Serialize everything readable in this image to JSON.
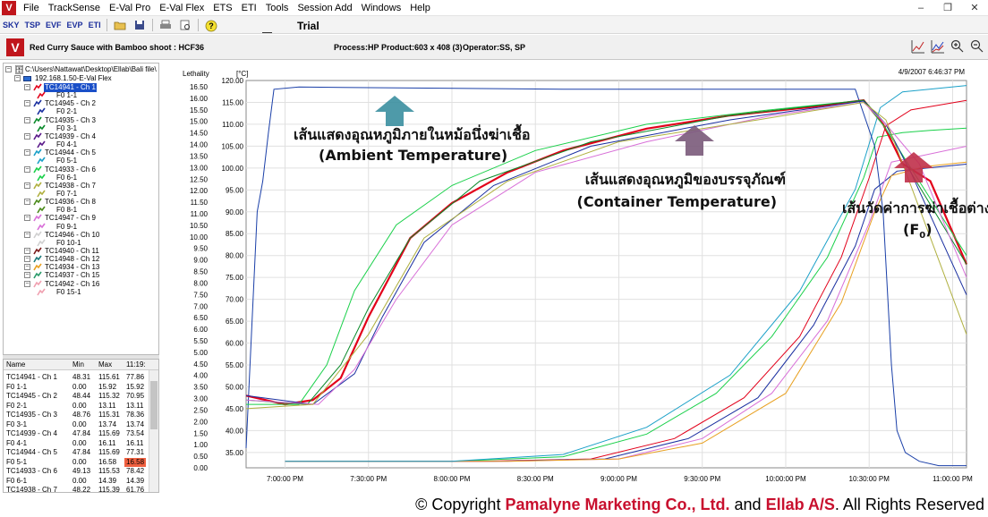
{
  "menubar": {
    "logo": "V",
    "items": [
      "File",
      "TrackSense",
      "E-Val Pro",
      "E-Val Flex",
      "ETS",
      "ETI",
      "Tools",
      "Session Add",
      "Windows",
      "Help"
    ],
    "window_controls": [
      "–",
      "❐",
      "✕"
    ]
  },
  "toolbar": {
    "buttons": [
      "SKY",
      "TSP",
      "EVF",
      "EVP",
      "ETI"
    ],
    "title": "Trial"
  },
  "infobar": {
    "product": "Red Curry Sauce with Bamboo shoot : HCF36",
    "process": "Process:HP",
    "product_size": "Product:603 x 408 (3)",
    "operator": "Operator:SS, SP"
  },
  "tree": {
    "root": "C:\\Users\\Nattawat\\Desktop\\Ellab\\Bali file\\",
    "device": "192.168.1.50-E-Val Flex",
    "channels": [
      {
        "label": "TC14941 - Ch 1",
        "color": "#e2001a",
        "f0": "F0 1-1",
        "f0color": "#e2001a",
        "selected": true
      },
      {
        "label": "TC14945 - Ch 2",
        "color": "#1a2fa0",
        "f0": "F0 2-1",
        "f0color": "#1a2fa0"
      },
      {
        "label": "TC14935 - Ch 3",
        "color": "#0a8a2a",
        "f0": "F0 3-1",
        "f0color": "#0a8a2a"
      },
      {
        "label": "TC14939 - Ch 4",
        "color": "#5a1a8a",
        "f0": "F0 4-1",
        "f0color": "#5a1a8a"
      },
      {
        "label": "TC14944 - Ch 5",
        "color": "#1aa0c8",
        "f0": "F0 5-1",
        "f0color": "#1aa0c8"
      },
      {
        "label": "TC14933 - Ch 6",
        "color": "#1ad04a",
        "f0": "F0 6-1",
        "f0color": "#1ad04a"
      },
      {
        "label": "TC14938 - Ch 7",
        "color": "#b0b040",
        "f0": "F0 7-1",
        "f0color": "#b0b040"
      },
      {
        "label": "TC14936 - Ch 8",
        "color": "#4a8a1a",
        "f0": "F0 8-1",
        "f0color": "#4a8a1a"
      },
      {
        "label": "TC14947 - Ch 9",
        "color": "#d870d8",
        "f0": "F0 9-1",
        "f0color": "#d870d8"
      },
      {
        "label": "TC14946 - Ch 10",
        "color": "#d0d0d0",
        "f0": "F0 10-1",
        "f0color": "#d0d0d0"
      }
    ],
    "extra_channels": [
      {
        "label": "TC14940 - Ch 11",
        "color": "#7a1a1a"
      },
      {
        "label": "TC14948 - Ch 12",
        "color": "#1a7a7a"
      },
      {
        "label": "TC14934 - Ch 13",
        "color": "#e8a020"
      },
      {
        "label": "TC14937 - Ch 15",
        "color": "#2a9a6a"
      },
      {
        "label": "TC14942 - Ch 16",
        "color": "#f0a0b0",
        "f0": "F0 15-1",
        "f0color": "#f0a0b0"
      }
    ]
  },
  "stats": {
    "headers": [
      "Name",
      "Min",
      "Max",
      "11:19:"
    ],
    "rows": [
      [
        "TC14941 - Ch 1",
        "48.31",
        "115.61",
        "77.86"
      ],
      [
        "F0 1-1",
        "0.00",
        "15.92",
        "15.92"
      ],
      [
        "TC14945 - Ch 2",
        "48.44",
        "115.32",
        "70.95"
      ],
      [
        "F0 2-1",
        "0.00",
        "13.11",
        "13.11"
      ],
      [
        "TC14935 - Ch 3",
        "48.76",
        "115.31",
        "78.36"
      ],
      [
        "F0 3-1",
        "0.00",
        "13.74",
        "13.74"
      ],
      [
        "TC14939 - Ch 4",
        "47.84",
        "115.69",
        "73.54"
      ],
      [
        "F0 4-1",
        "0.00",
        "16.11",
        "16.11"
      ],
      [
        "TC14944 - Ch 5",
        "47.84",
        "115.69",
        "77.31"
      ],
      [
        "F0 5-1",
        "0.00",
        "16.58",
        "16.58"
      ],
      [
        "TC14933 - Ch 6",
        "49.13",
        "115.53",
        "78.42"
      ],
      [
        "F0 6-1",
        "0.00",
        "14.39",
        "14.39"
      ],
      [
        "TC14938 - Ch 7",
        "48.22",
        "115.39",
        "61.76"
      ]
    ],
    "highlight_row": 9,
    "highlight_color": "#f06040"
  },
  "chart_data": {
    "type": "line",
    "title": "",
    "datetime": "4/9/2007 6:46:37 PM",
    "ylabel_left": "Lethality",
    "ylabel_right": "[°C]",
    "lethality_ticks": [
      "16.50",
      "16.00",
      "15.50",
      "15.00",
      "14.50",
      "14.00",
      "13.50",
      "13.00",
      "12.50",
      "12.00",
      "11.50",
      "11.00",
      "10.50",
      "10.00",
      "9.50",
      "9.00",
      "8.50",
      "8.00",
      "7.50",
      "7.00",
      "6.50",
      "6.00",
      "5.50",
      "5.00",
      "4.50",
      "4.00",
      "3.50",
      "3.00",
      "2.50",
      "2.00",
      "1.50",
      "1.00",
      "0.50",
      "0.00"
    ],
    "temp_ticks": [
      "120.00",
      "115.00",
      "110.00",
      "105.00",
      "100.00",
      "95.00",
      "90.00",
      "85.00",
      "80.00",
      "75.00",
      "70.00",
      "65.00",
      "60.00",
      "55.00",
      "50.00",
      "45.00",
      "40.00",
      "35.00"
    ],
    "ylim_temp": [
      31.5,
      120
    ],
    "x_ticks": [
      "7:00:00 PM",
      "7:30:00 PM",
      "8:00:00 PM",
      "8:30:00 PM",
      "9:00:00 PM",
      "9:30:00 PM",
      "10:00:00 PM",
      "10:30:00 PM",
      "11:00:00 PM"
    ],
    "xlim_minutes": [
      -14,
      245
    ],
    "x_unit": "minutes after 7:00:00 PM",
    "series_temp": [
      {
        "color": "#1a3fa8",
        "x": [
          -14,
          -10,
          -8,
          -6,
          -4,
          5,
          100,
          205,
          212,
          215,
          218,
          220,
          223,
          228,
          235,
          245
        ],
        "y": [
          36,
          90,
          97,
          108,
          118,
          118.5,
          118,
          118,
          105,
          90,
          55,
          40,
          35,
          33,
          32,
          32
        ]
      },
      {
        "color": "#e2001a",
        "width": 2.2,
        "x": [
          -14,
          0,
          10,
          20,
          30,
          45,
          60,
          80,
          100,
          130,
          160,
          190,
          208,
          215,
          222,
          232,
          245
        ],
        "y": [
          48,
          46,
          47,
          52,
          66,
          84,
          92,
          99,
          104,
          109,
          112,
          114,
          115.5,
          110,
          101,
          97,
          78
        ]
      },
      {
        "color": "#1ad04a",
        "x": [
          -14,
          5,
          15,
          25,
          40,
          60,
          90,
          130,
          170,
          208,
          216,
          225,
          245
        ],
        "y": [
          46,
          46,
          55,
          72,
          87,
          96,
          104,
          110,
          113,
          115.5,
          109,
          100,
          80
        ]
      },
      {
        "color": "#0a8a2a",
        "x": [
          -14,
          8,
          20,
          30,
          45,
          70,
          110,
          160,
          208,
          216,
          225,
          245
        ],
        "y": [
          47,
          46,
          55,
          68,
          84,
          97,
          106,
          112,
          115.5,
          110,
          99,
          78
        ]
      },
      {
        "color": "#1a2fa0",
        "x": [
          -14,
          10,
          25,
          35,
          50,
          75,
          110,
          160,
          208,
          216,
          225,
          245
        ],
        "y": [
          48,
          46,
          53,
          66,
          83,
          96,
          105,
          111,
          115.3,
          110,
          99,
          71
        ]
      },
      {
        "color": "#d870d8",
        "x": [
          -14,
          12,
          25,
          40,
          60,
          90,
          130,
          175,
          208,
          216,
          228,
          245
        ],
        "y": [
          47,
          46,
          54,
          70,
          87,
          99,
          106,
          112,
          115,
          110,
          101,
          75
        ]
      },
      {
        "color": "#b0b040",
        "x": [
          -14,
          10,
          30,
          50,
          80,
          120,
          170,
          208,
          216,
          225,
          245
        ],
        "y": [
          45,
          46,
          62,
          84,
          97,
          106,
          111,
          115,
          111,
          96,
          62
        ]
      }
    ],
    "series_lethality": [
      {
        "color": "#1ad04a",
        "x": [
          0,
          60,
          100,
          130,
          155,
          175,
          195,
          208,
          213,
          222,
          232,
          245
        ],
        "y": [
          0,
          0,
          0.2,
          1.2,
          3,
          5.5,
          9,
          12.5,
          14.3,
          14.5,
          14.6,
          14.7
        ]
      },
      {
        "color": "#e2001a",
        "x": [
          0,
          70,
          110,
          140,
          165,
          185,
          200,
          210,
          216,
          225,
          245
        ],
        "y": [
          0,
          0,
          0.1,
          1,
          2.8,
          5.5,
          9,
          12.5,
          14.8,
          15.5,
          15.92
        ]
      },
      {
        "color": "#1a2fa0",
        "x": [
          0,
          75,
          115,
          145,
          170,
          190,
          205,
          212,
          220,
          245
        ],
        "y": [
          0,
          0,
          0.1,
          1,
          2.8,
          6,
          9.5,
          12,
          12.8,
          13.11
        ]
      },
      {
        "color": "#d870d8",
        "x": [
          0,
          80,
          120,
          150,
          175,
          195,
          210,
          218,
          245
        ],
        "y": [
          0,
          0,
          0.1,
          1,
          3,
          6.2,
          10.5,
          13.2,
          13.9
        ]
      },
      {
        "color": "#e8a020",
        "x": [
          0,
          80,
          120,
          150,
          180,
          200,
          212,
          218,
          230,
          245
        ],
        "y": [
          0,
          0,
          0.1,
          0.8,
          3,
          7,
          11,
          12.6,
          13,
          13.2
        ]
      },
      {
        "color": "#1aa0c8",
        "x": [
          0,
          60,
          100,
          130,
          160,
          185,
          205,
          214,
          222,
          245
        ],
        "y": [
          0,
          0,
          0.3,
          1.5,
          3.8,
          7.5,
          12,
          15.6,
          16.3,
          16.58
        ]
      }
    ],
    "annotations": [
      {
        "line1": "เส้นแสดงอุณหภูมิภายในหม้อนึ่งฆ่าเชื้อ",
        "line2": "(Ambient Temperature)",
        "arrow_color": "#3b8fa0"
      },
      {
        "line1": "เส้นแสดงอุณหภูมิของบรรจุภัณฑ์",
        "line2": "(Container Temperature)",
        "arrow_color": "#7a5a7a"
      },
      {
        "line1": "เส้นวัดค่าการฆ่าเชื้อต่างๆ",
        "line2": "(F",
        "line2_sub": "0",
        "line2_end": ")",
        "arrow_color": "#c0304a"
      }
    ]
  },
  "footer": {
    "prefix": "© Copyright ",
    "company": "Pamalyne Marketing Co., Ltd.",
    "middle": " and ",
    "partner": "Ellab A/S",
    "suffix": ". All Rights Reserved"
  }
}
